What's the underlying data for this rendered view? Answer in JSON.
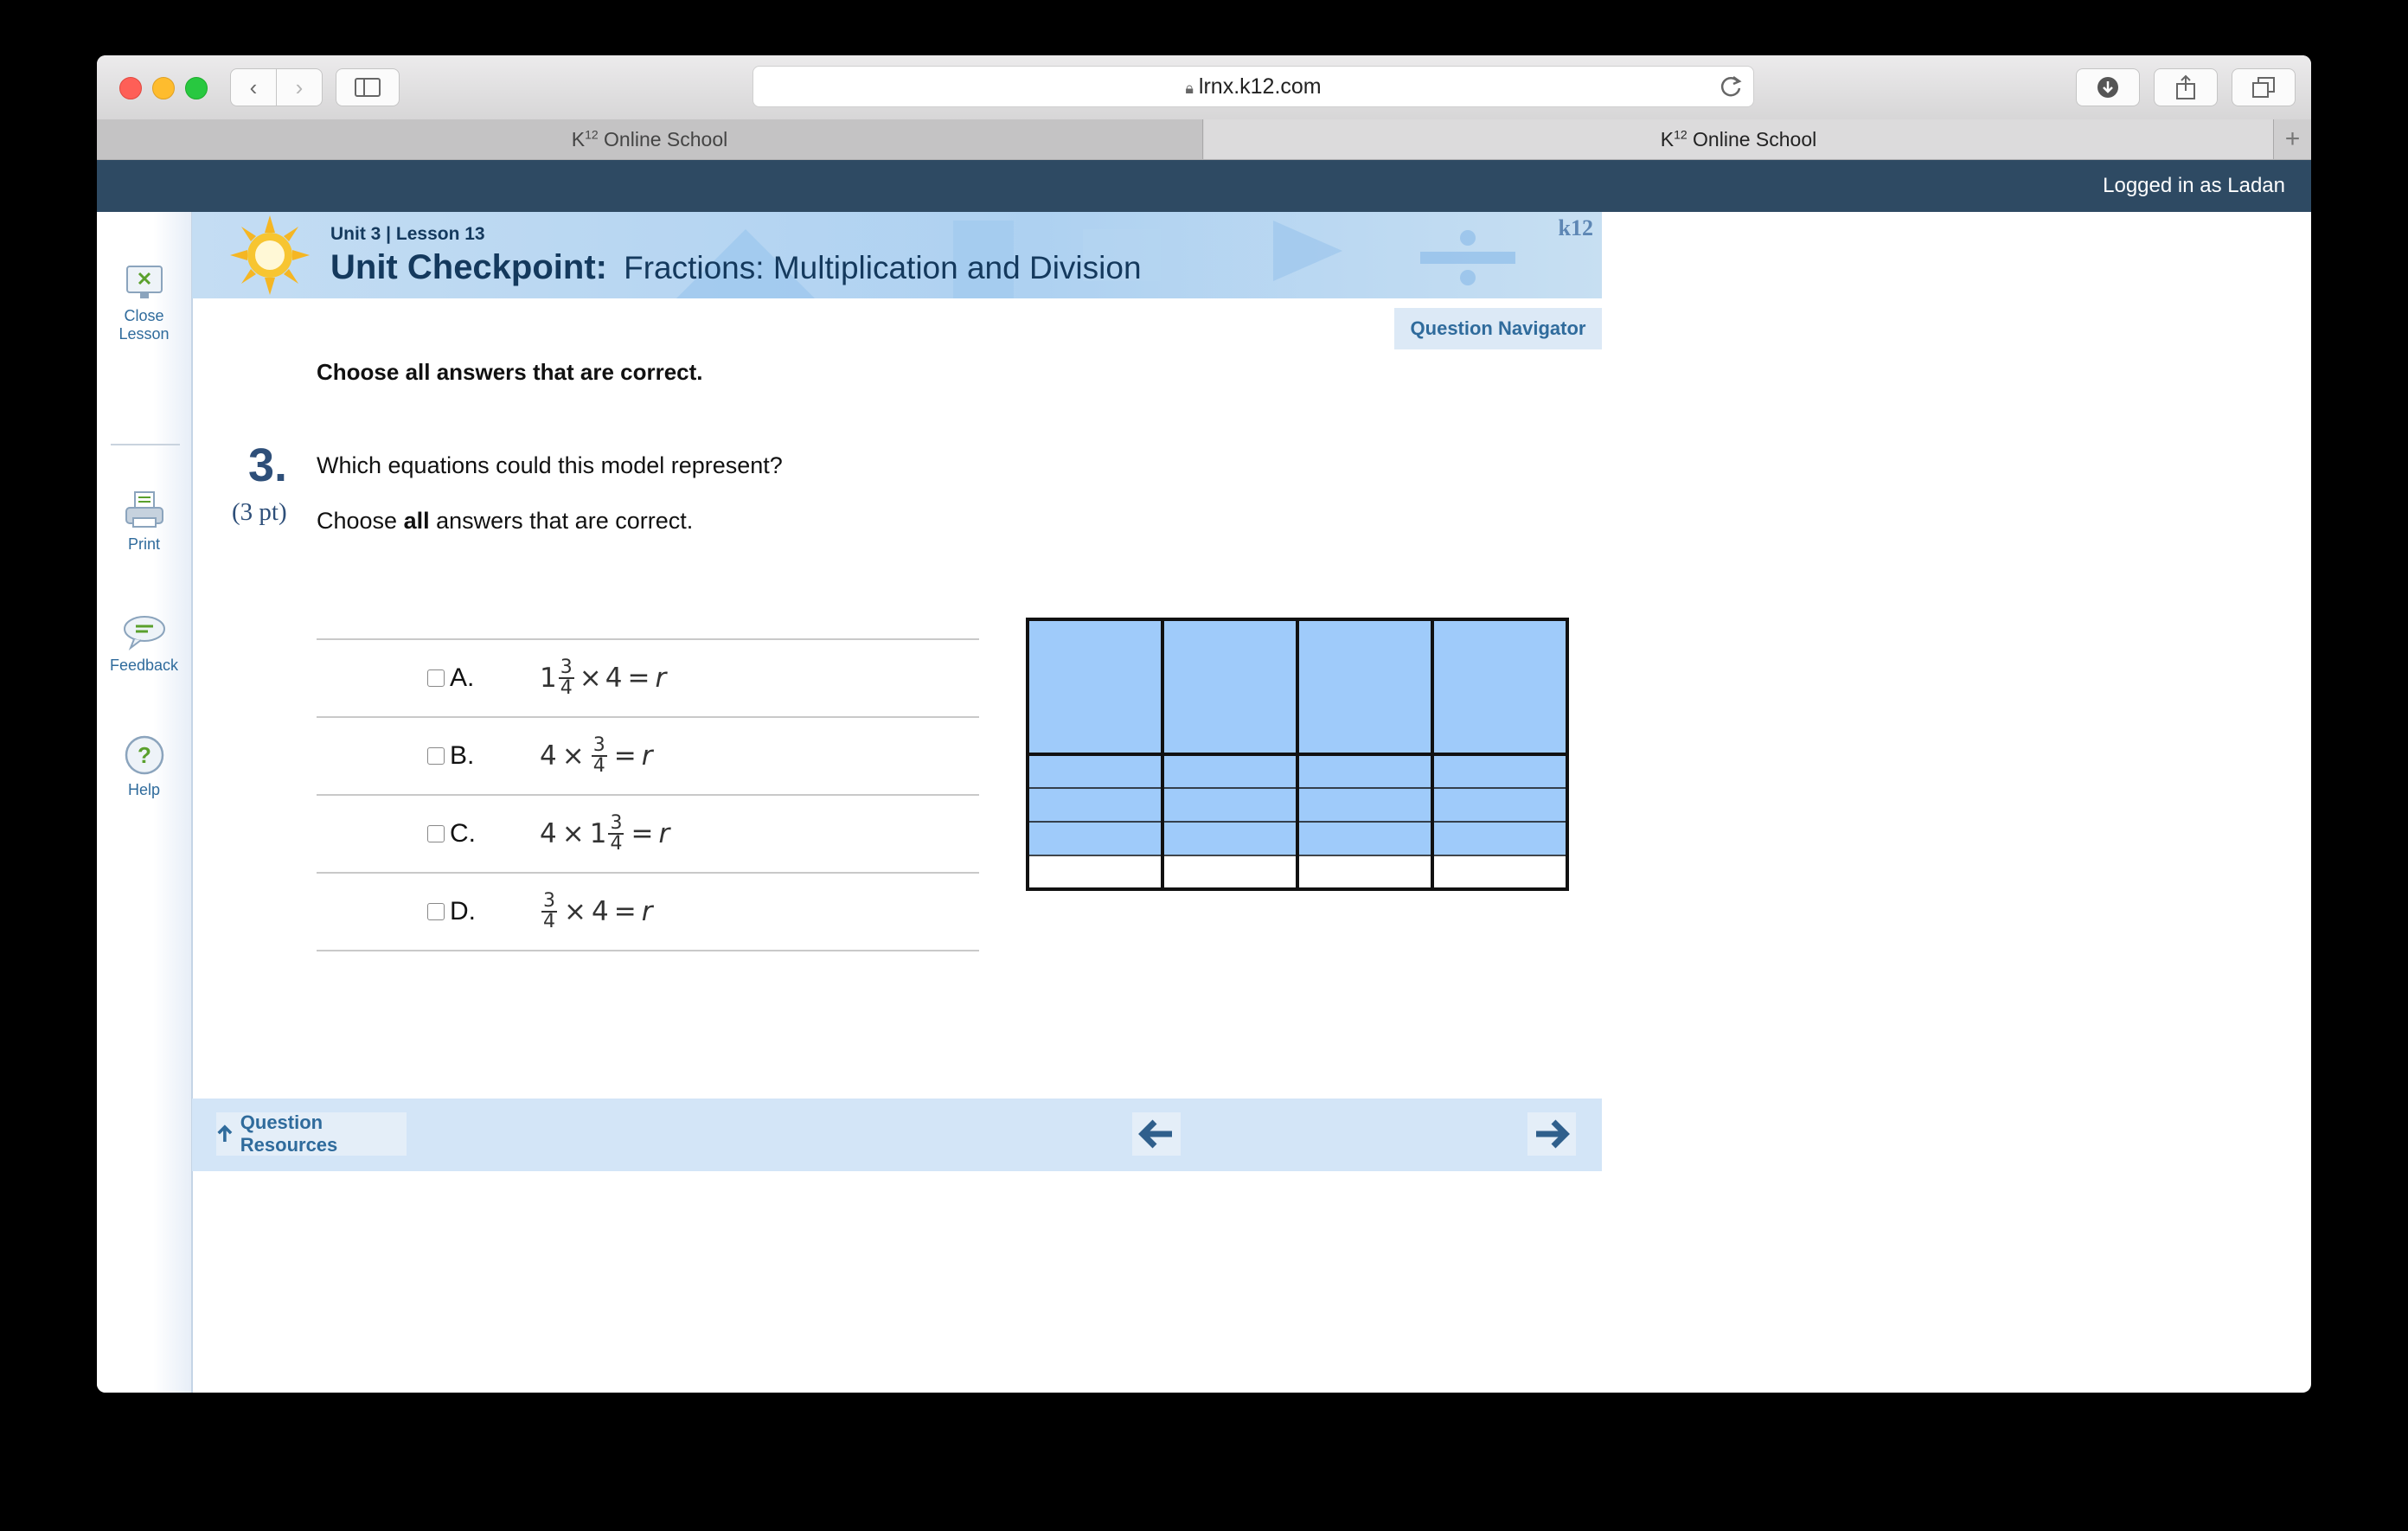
{
  "browser": {
    "url": "lrnx.k12.com",
    "tabs": [
      {
        "prefix": "K",
        "sup": "12",
        "label": " Online School"
      },
      {
        "prefix": "K",
        "sup": "12",
        "label": " Online School"
      }
    ],
    "new_tab_glyph": "+"
  },
  "header": {
    "logged_in": "Logged in as Ladan"
  },
  "sidebar": {
    "items": [
      {
        "label": "Close Lesson",
        "icon": "close-lesson-icon"
      },
      {
        "label": "Print",
        "icon": "printer-icon"
      },
      {
        "label": "Feedback",
        "icon": "speech-bubble-icon"
      },
      {
        "label": "Help",
        "icon": "help-icon"
      }
    ]
  },
  "banner": {
    "unit_lesson": "Unit 3 | Lesson 13",
    "title_bold": "Unit Checkpoint:",
    "title_rest": "Fractions: Multiplication and Division",
    "logo": "k12"
  },
  "question_navigator": "Question Navigator",
  "instruction": "Choose all answers that are correct.",
  "question": {
    "number": "3.",
    "points": "(3 pt)",
    "text": "Which equations could this model represent?",
    "sub_pre": "Choose ",
    "sub_bold": "all",
    "sub_post": " answers that are correct."
  },
  "choices": [
    {
      "letter": "A.",
      "whole1": "1",
      "num": "3",
      "den": "4",
      "op": "×",
      "factor": "4",
      "eq": "=",
      "var": "r"
    },
    {
      "letter": "B.",
      "factor": "4",
      "op": "×",
      "num": "3",
      "den": "4",
      "eq": "=",
      "var": "r"
    },
    {
      "letter": "C.",
      "factor": "4",
      "op": "×",
      "whole1": "1",
      "num": "3",
      "den": "4",
      "eq": "=",
      "var": "r"
    },
    {
      "letter": "D.",
      "num": "3",
      "den": "4",
      "op": "×",
      "factor": "4",
      "eq": "=",
      "var": "r"
    }
  ],
  "model": {
    "columns": 4,
    "rows_per_part": 4,
    "shaded_rows_second_part": 3,
    "shade_color": "#9fcbfa"
  },
  "footer": {
    "resources": "Question Resources",
    "prev_icon": "left-arrow-icon",
    "next_icon": "right-arrow-icon"
  }
}
